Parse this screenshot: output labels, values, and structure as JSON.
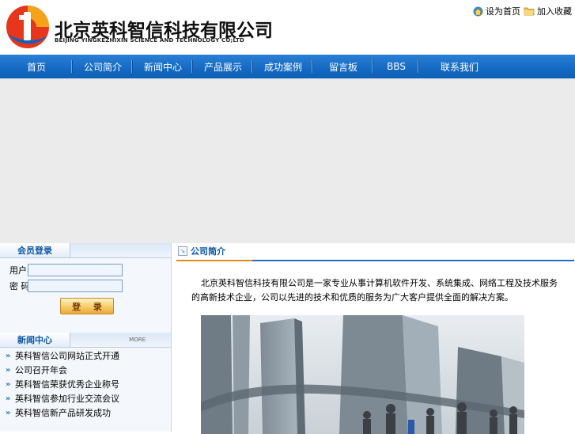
{
  "header": {
    "logo_cn": "北京英科智信科技有限公司",
    "logo_en": "BEIJING YINGKEZHIXIN SCIENCE AND TECHNOLOGY CO;LTD",
    "toplinks": [
      {
        "label": "设为首页",
        "icon": "home-icon"
      },
      {
        "label": "加入收藏",
        "icon": "folder-icon"
      }
    ]
  },
  "nav": {
    "items": [
      {
        "label": "首页",
        "width": 92
      },
      {
        "label": "公司简介",
        "width": 76
      },
      {
        "label": "新闻中心",
        "width": 76
      },
      {
        "label": "产品展示",
        "width": 76
      },
      {
        "label": "成功案例",
        "width": 76
      },
      {
        "label": "留言板",
        "width": 76
      },
      {
        "label": "BBS",
        "width": 58
      },
      {
        "label": "联系我们",
        "width": 102
      }
    ]
  },
  "login": {
    "title": "会员登录",
    "username_label": "用户名称",
    "username_value": "",
    "password_label": "密 码",
    "password_value": "",
    "button_label": "登 录"
  },
  "news": {
    "title": "新闻中心",
    "more": "MORE",
    "items": [
      "英科智信公司网站正式开通",
      "公司召开年会",
      "英科智信荣获优秀企业称号",
      "英科智信参加行业交流会议",
      "英科智信新产品研发成功"
    ]
  },
  "about": {
    "title": "公司简介",
    "text": "北京英科智信科技有限公司是一家专业从事计算机软件开发、系统集成、网络工程及技术服务的高新技术企业，公司以先进的技术和优质的服务为广大客户提供全面的解决方案。"
  },
  "colors": {
    "nav_bg": "#1469c2",
    "accent": "#0c56a8",
    "orange": "#e08a1e"
  }
}
